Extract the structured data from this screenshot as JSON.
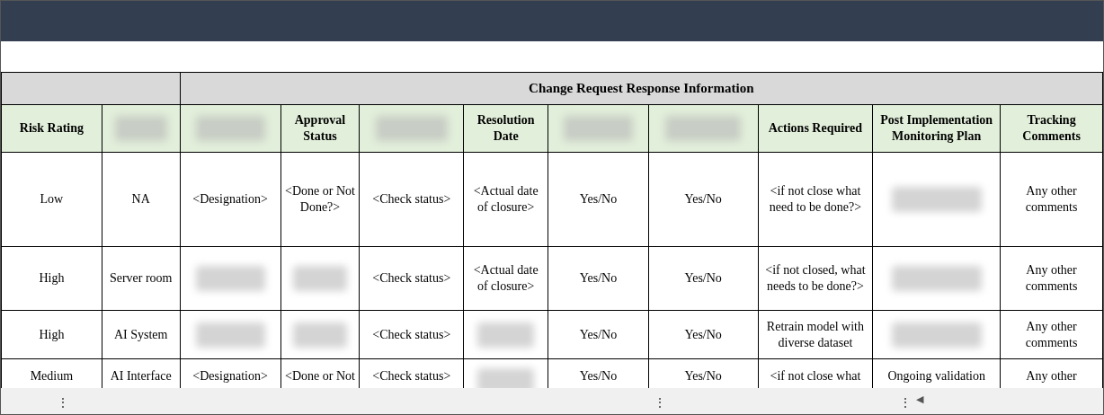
{
  "group_header": {
    "title": "Change Request Response Information"
  },
  "table": {
    "columns": [
      {
        "kind": "text",
        "text": "Risk Rating"
      },
      {
        "kind": "blurred"
      },
      {
        "kind": "blurred"
      },
      {
        "kind": "text",
        "text": "Approval Status"
      },
      {
        "kind": "blurred"
      },
      {
        "kind": "text",
        "text": "Resolution Date"
      },
      {
        "kind": "blurred"
      },
      {
        "kind": "blurred"
      },
      {
        "kind": "text",
        "text": "Actions Required"
      },
      {
        "kind": "text",
        "text": "Post Implementation Monitoring Plan"
      },
      {
        "kind": "text",
        "text": "Tracking Comments"
      }
    ],
    "rows": [
      [
        {
          "kind": "text",
          "text": "Low"
        },
        {
          "kind": "text",
          "text": "NA"
        },
        {
          "kind": "text",
          "text": "<Designation>"
        },
        {
          "kind": "text",
          "text": "<Done or Not Done?>"
        },
        {
          "kind": "text",
          "text": "<Check status>"
        },
        {
          "kind": "text",
          "text": "<Actual date of closure>"
        },
        {
          "kind": "text",
          "text": "Yes/No"
        },
        {
          "kind": "text",
          "text": "Yes/No"
        },
        {
          "kind": "text",
          "text": "<if not close what need to be done?>"
        },
        {
          "kind": "blurred"
        },
        {
          "kind": "text",
          "text": "Any other comments"
        }
      ],
      [
        {
          "kind": "text",
          "text": "High"
        },
        {
          "kind": "text",
          "text": "Server room"
        },
        {
          "kind": "blurred"
        },
        {
          "kind": "blurred"
        },
        {
          "kind": "text",
          "text": "<Check status>"
        },
        {
          "kind": "text",
          "text": "<Actual date of closure>"
        },
        {
          "kind": "text",
          "text": "Yes/No"
        },
        {
          "kind": "text",
          "text": "Yes/No"
        },
        {
          "kind": "text",
          "text": "<if not closed, what needs to be done?>"
        },
        {
          "kind": "blurred"
        },
        {
          "kind": "text",
          "text": "Any other comments"
        }
      ],
      [
        {
          "kind": "text",
          "text": "High"
        },
        {
          "kind": "text",
          "text": "AI System"
        },
        {
          "kind": "blurred"
        },
        {
          "kind": "blurred"
        },
        {
          "kind": "text",
          "text": "<Check status>"
        },
        {
          "kind": "blurred"
        },
        {
          "kind": "text",
          "text": "Yes/No"
        },
        {
          "kind": "text",
          "text": "Yes/No"
        },
        {
          "kind": "text",
          "text": "Retrain model with diverse dataset"
        },
        {
          "kind": "blurred"
        },
        {
          "kind": "text",
          "text": "Any other comments"
        }
      ],
      [
        {
          "kind": "text",
          "text": "Medium"
        },
        {
          "kind": "text",
          "text": "AI Interface"
        },
        {
          "kind": "text",
          "text": "<Designation>"
        },
        {
          "kind": "text",
          "text": "<Done or Not"
        },
        {
          "kind": "text",
          "text": "<Check status>"
        },
        {
          "kind": "blurred"
        },
        {
          "kind": "text",
          "text": "Yes/No"
        },
        {
          "kind": "text",
          "text": "Yes/No"
        },
        {
          "kind": "text",
          "text": "<if not close what"
        },
        {
          "kind": "text",
          "text": "Ongoing validation"
        },
        {
          "kind": "text",
          "text": "Any other"
        }
      ]
    ]
  },
  "status_bar": {
    "handles": [
      "⋮",
      "⋮",
      "⋮"
    ],
    "scroll_left": "◀"
  }
}
